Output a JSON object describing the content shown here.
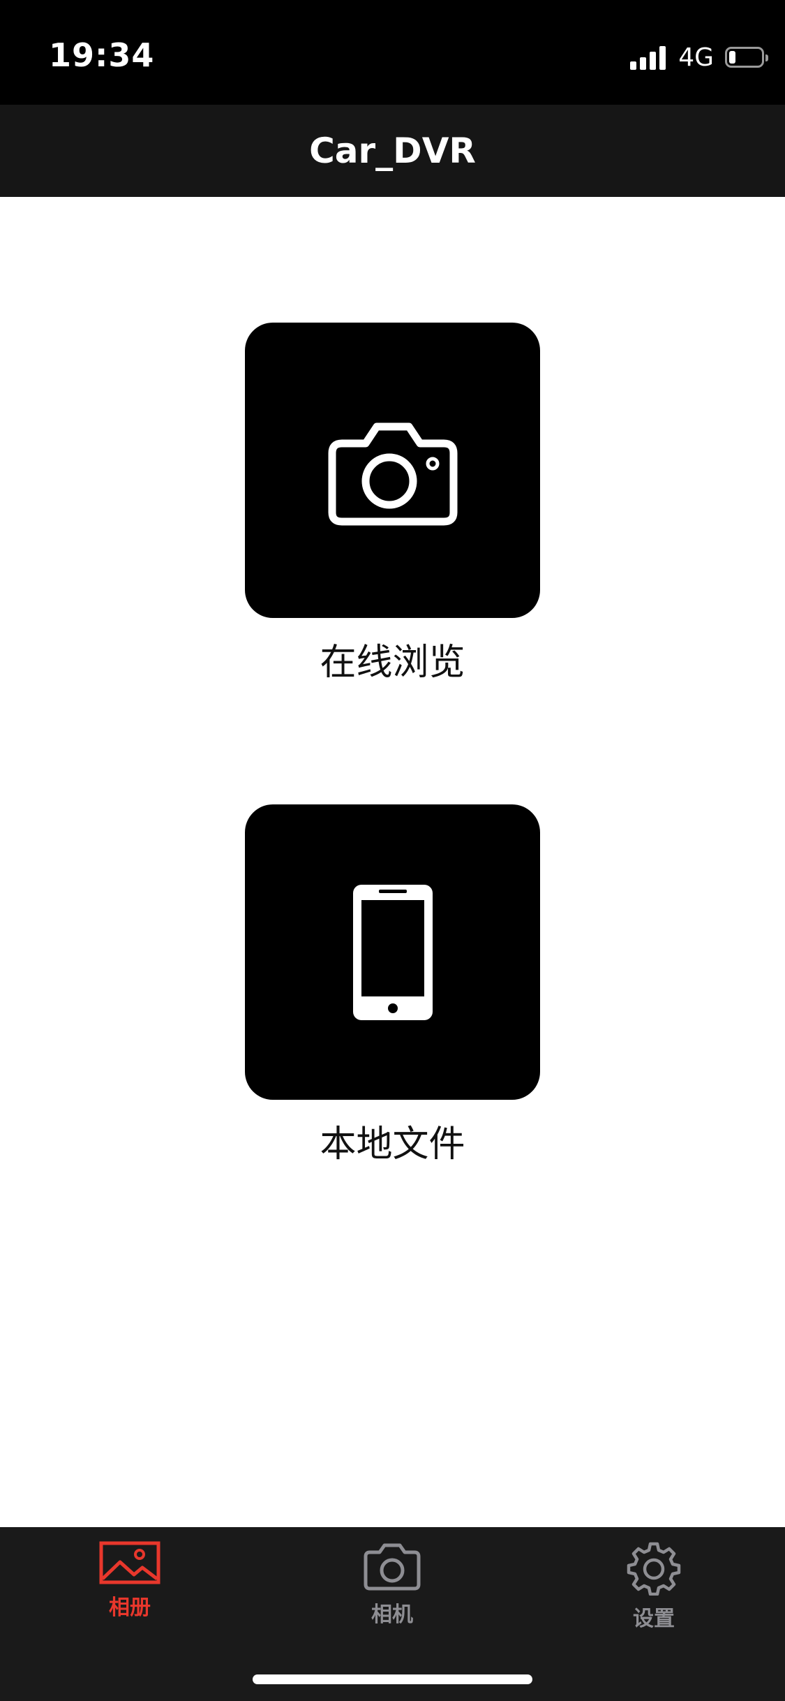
{
  "status_bar": {
    "time": "19:34",
    "network": "4G",
    "battery_level": 0.2
  },
  "nav": {
    "title": "Car_DVR"
  },
  "main": {
    "online_browse_label": "在线浏览",
    "local_files_label": "本地文件"
  },
  "tabs": [
    {
      "label": "相册",
      "icon": "album-icon",
      "active": true
    },
    {
      "label": "相机",
      "icon": "camera-icon",
      "active": false
    },
    {
      "label": "设置",
      "icon": "gear-icon",
      "active": false
    }
  ],
  "colors": {
    "accent": "#e8372c",
    "inactive_tab": "#8e8e93",
    "nav_background": "#161616",
    "tab_background": "#1a1a1a"
  }
}
